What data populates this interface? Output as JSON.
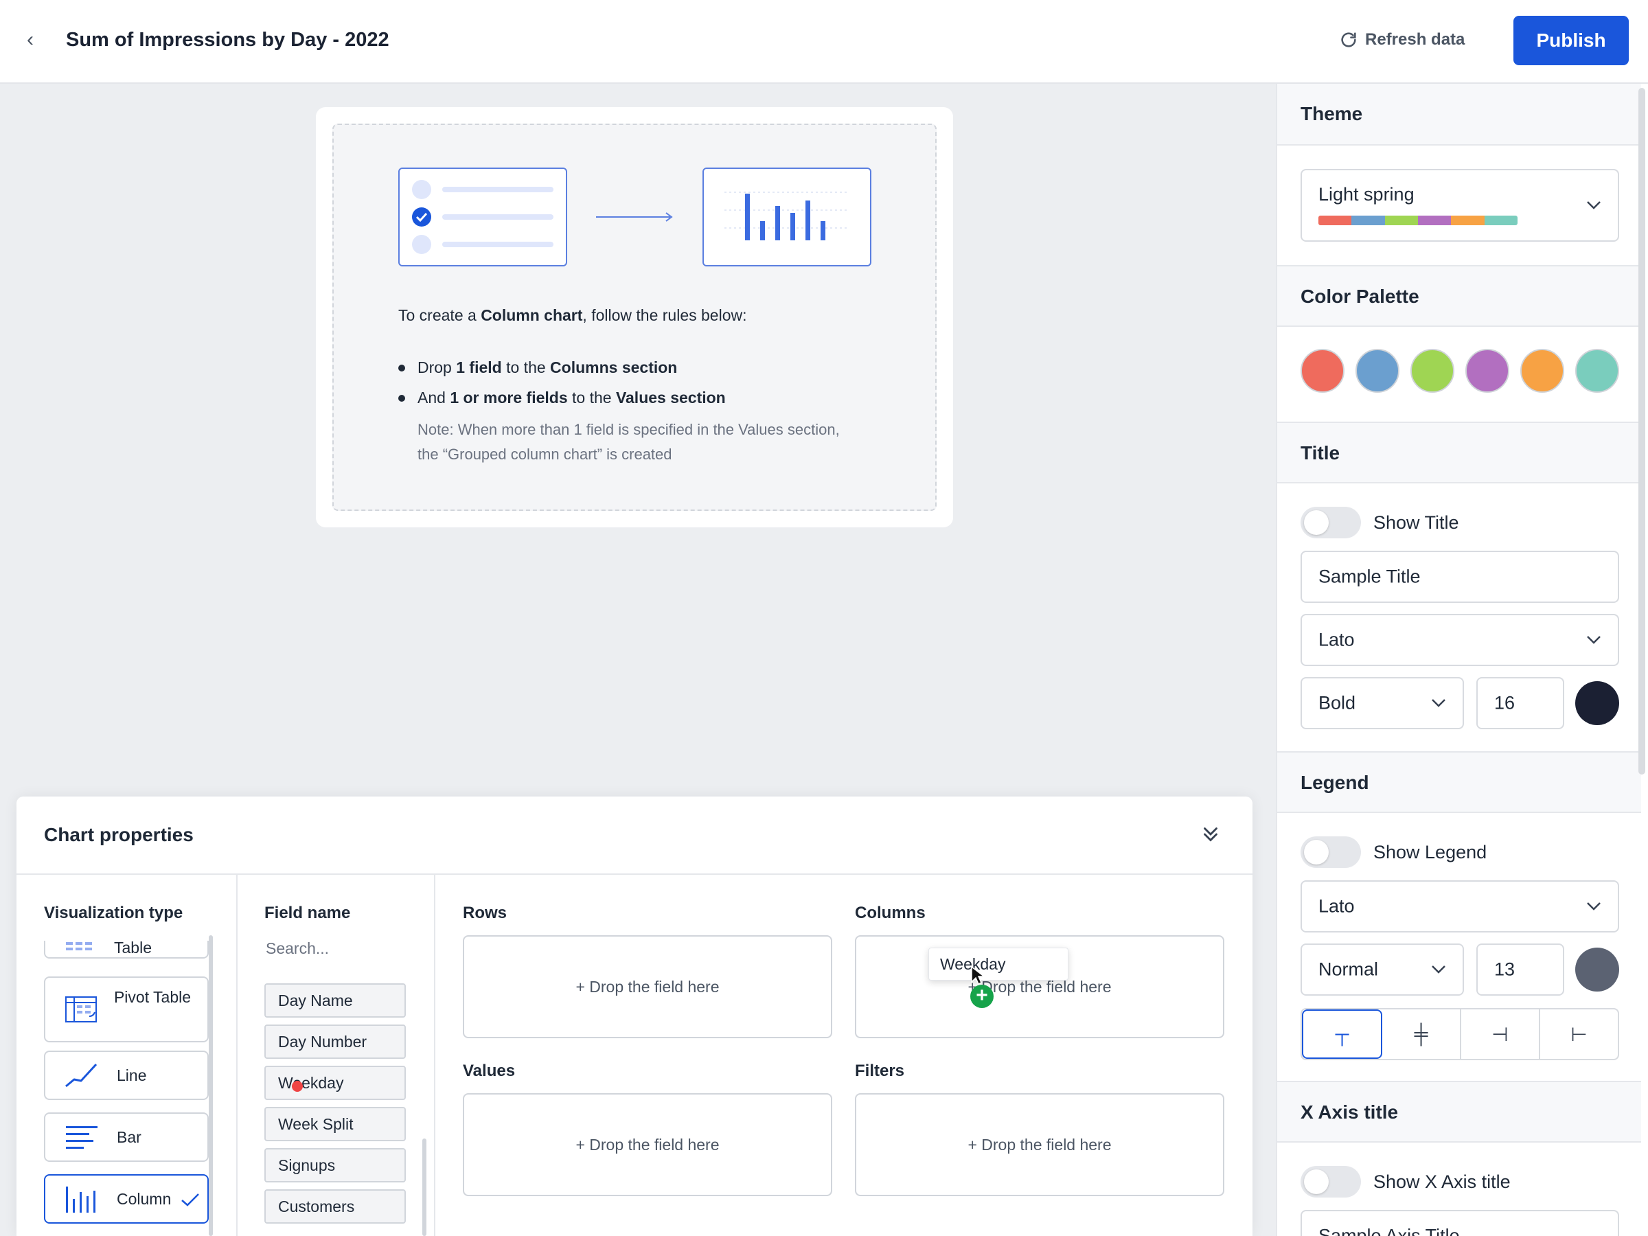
{
  "header": {
    "title": "Sum of Impressions by Day - 2022",
    "refresh_label": "Refresh data",
    "publish_label": "Publish"
  },
  "canvas": {
    "intro_prefix": "To create a ",
    "intro_bold": "Column chart",
    "intro_suffix": ", follow the rules below:",
    "rules": [
      {
        "a": "Drop ",
        "b": "1 field",
        "c": " to the ",
        "d": "Columns section"
      },
      {
        "a": "And ",
        "b": "1 or more fields",
        "c": " to the ",
        "d": "Values section"
      }
    ],
    "note": "Note: When more than 1 field is specified in the Values section, the “Grouped column chart” is created"
  },
  "chart_properties": {
    "title": "Chart properties",
    "viz_title": "Visualization type",
    "viz_types": [
      {
        "label": "Table",
        "icon": "table-icon"
      },
      {
        "label": "Pivot Table",
        "icon": "pivot-table-icon"
      },
      {
        "label": "Line",
        "icon": "line-chart-icon"
      },
      {
        "label": "Bar",
        "icon": "bar-chart-icon"
      },
      {
        "label": "Column",
        "icon": "column-chart-icon",
        "selected": true
      }
    ],
    "field_title": "Field name",
    "search_placeholder": "Search...",
    "fields": [
      "Day Name",
      "Day Number",
      "Weekday",
      "Week Split",
      "Signups",
      "Customers"
    ],
    "rows_label": "Rows",
    "columns_label": "Columns",
    "values_label": "Values",
    "filters_label": "Filters",
    "drop_hint": "+ Drop the field here",
    "dragging_field": "Weekday"
  },
  "sidebar": {
    "theme": {
      "label": "Theme",
      "value": "Light spring",
      "colors": [
        "#ef6b5d",
        "#6b9fcf",
        "#9fd553",
        "#b26fc0",
        "#f7a244",
        "#7acdbd"
      ]
    },
    "palette": {
      "label": "Color Palette",
      "colors": [
        "#ef6b5d",
        "#6b9fcf",
        "#9fd553",
        "#b26fc0",
        "#f7a244",
        "#7acdbd"
      ]
    },
    "title": {
      "label": "Title",
      "toggle_label": "Show Title",
      "text": "Sample Title",
      "font": "Lato",
      "weight": "Bold",
      "size": "16",
      "color": "#1b2033"
    },
    "legend": {
      "label": "Legend",
      "toggle_label": "Show Legend",
      "font": "Lato",
      "weight": "Normal",
      "size": "13",
      "color": "#5b6272"
    },
    "x_axis": {
      "label": "X Axis title",
      "toggle_label": "Show X Axis title",
      "text": "Sample Axis Title"
    }
  }
}
